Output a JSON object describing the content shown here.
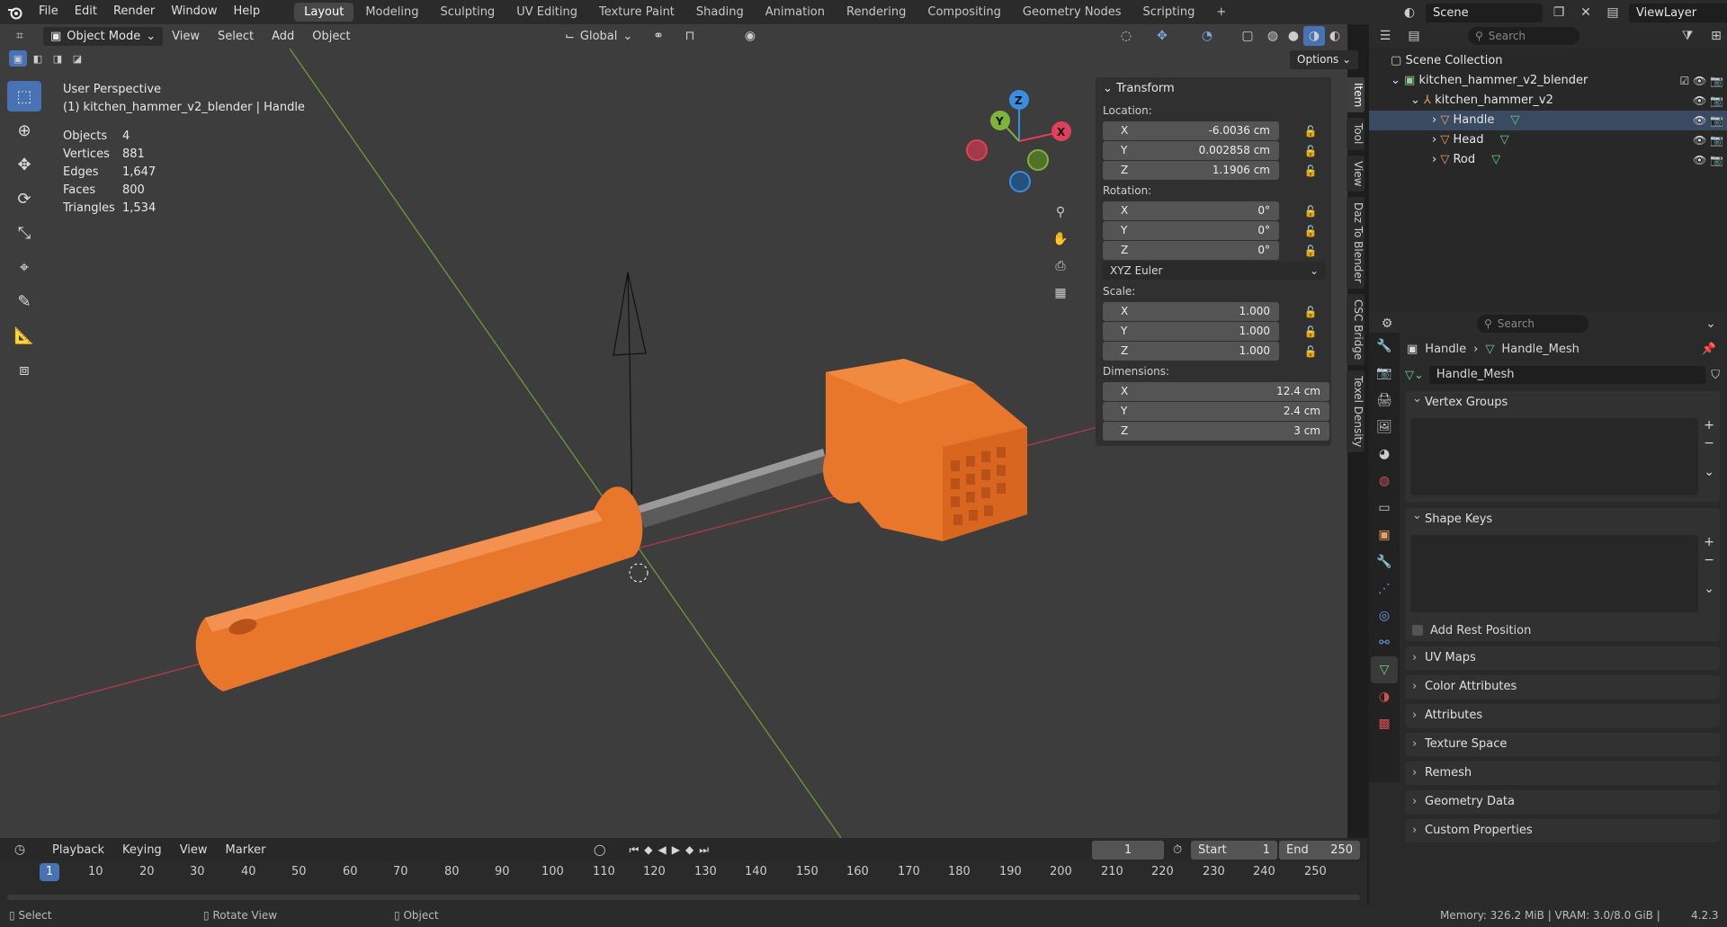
{
  "app": {
    "menus": [
      "File",
      "Edit",
      "Render",
      "Window",
      "Help"
    ],
    "workspaces": [
      "Layout",
      "Modeling",
      "Sculpting",
      "UV Editing",
      "Texture Paint",
      "Shading",
      "Animation",
      "Rendering",
      "Compositing",
      "Geometry Nodes",
      "Scripting"
    ],
    "active_workspace": "Layout",
    "scene": "Scene",
    "view_layer": "ViewLayer"
  },
  "viewport": {
    "mode": "Object Mode",
    "menus": [
      "View",
      "Select",
      "Add",
      "Object"
    ],
    "orientation": "Global",
    "options_label": "Options",
    "perspective": "User Perspective",
    "active_object": "(1) kitchen_hammer_v2_blender | Handle",
    "stats": [
      {
        "k": "Objects",
        "v": "4"
      },
      {
        "k": "Vertices",
        "v": "881"
      },
      {
        "k": "Edges",
        "v": "1,647"
      },
      {
        "k": "Faces",
        "v": "800"
      },
      {
        "k": "Triangles",
        "v": "1,534"
      }
    ],
    "gizmo_axes": {
      "x": "X",
      "y": "Y",
      "z": "Z"
    }
  },
  "npanel": {
    "title": "Transform",
    "location_label": "Location:",
    "location": [
      {
        "a": "X",
        "v": "-6.0036 cm"
      },
      {
        "a": "Y",
        "v": "0.002858 cm"
      },
      {
        "a": "Z",
        "v": "1.1906 cm"
      }
    ],
    "rotation_label": "Rotation:",
    "rotation": [
      {
        "a": "X",
        "v": "0°"
      },
      {
        "a": "Y",
        "v": "0°"
      },
      {
        "a": "Z",
        "v": "0°"
      }
    ],
    "rotation_mode": "XYZ Euler",
    "scale_label": "Scale:",
    "scale": [
      {
        "a": "X",
        "v": "1.000"
      },
      {
        "a": "Y",
        "v": "1.000"
      },
      {
        "a": "Z",
        "v": "1.000"
      }
    ],
    "dimensions_label": "Dimensions:",
    "dimensions": [
      {
        "a": "X",
        "v": "12.4 cm"
      },
      {
        "a": "Y",
        "v": "2.4 cm"
      },
      {
        "a": "Z",
        "v": "3 cm"
      }
    ],
    "tabs": [
      "Item",
      "Tool",
      "View",
      "Daz To Blender",
      "CSC Bridge",
      "Texel Density"
    ]
  },
  "outliner": {
    "search_placeholder": "Search",
    "root": "Scene Collection",
    "collection": "kitchen_hammer_v2_blender",
    "parent": "kitchen_hammer_v2",
    "children": [
      "Handle",
      "Head",
      "Rod"
    ]
  },
  "properties": {
    "search_placeholder": "Search",
    "breadcrumb_object": "Handle",
    "breadcrumb_mesh": "Handle_Mesh",
    "mesh_name": "Handle_Mesh",
    "vertex_groups": "Vertex Groups",
    "shape_keys": "Shape Keys",
    "add_rest_position": "Add Rest Position",
    "collapsed_panels": [
      "UV Maps",
      "Color Attributes",
      "Attributes",
      "Texture Space",
      "Remesh",
      "Geometry Data",
      "Custom Properties"
    ]
  },
  "timeline": {
    "menus": [
      "Playback",
      "Keying",
      "View",
      "Marker"
    ],
    "current_frame": "1",
    "start_label": "Start",
    "start": "1",
    "end_label": "End",
    "end": "250",
    "ticks": [
      "1",
      "10",
      "20",
      "30",
      "40",
      "50",
      "60",
      "70",
      "80",
      "90",
      "100",
      "110",
      "120",
      "130",
      "140",
      "150",
      "160",
      "170",
      "180",
      "190",
      "200",
      "210",
      "220",
      "230",
      "240",
      "250"
    ]
  },
  "statusbar": {
    "select": "Select",
    "rotate": "Rotate View",
    "object": "Object",
    "memory": "Memory: 326.2 MiB | VRAM: 3.0/8.0 GiB |",
    "version": "4.2.3"
  },
  "colors": {
    "accent": "#4772b3",
    "handle_orange": "#e8762b",
    "x_axis": "#e0405a",
    "y_axis": "#7fb33c",
    "z_axis": "#3a8ee0"
  }
}
